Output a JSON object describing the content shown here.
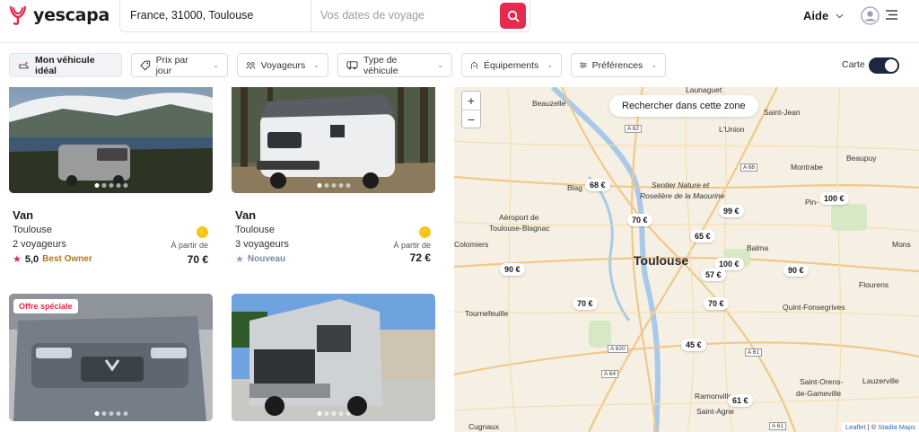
{
  "header": {
    "logo_text": "yescapa",
    "search_location": "France, 31000, Toulouse",
    "search_dates_placeholder": "Vos dates de voyage",
    "help_label": "Aide"
  },
  "filters": {
    "items": [
      {
        "label": "Mon véhicule idéal",
        "icon": "sparkle-van-icon"
      },
      {
        "label": "Prix par jour",
        "icon": "price-tag-icon"
      },
      {
        "label": "Voyageurs",
        "icon": "people-icon"
      },
      {
        "label": "Type de véhicule",
        "icon": "van-icon"
      },
      {
        "label": "Équipements",
        "icon": "equipment-icon"
      },
      {
        "label": "Préférences",
        "icon": "sliders-icon"
      }
    ],
    "map_toggle_label": "Carte",
    "map_toggle_on": true
  },
  "listings": [
    {
      "title": "Van",
      "city": "Toulouse",
      "travelers": "2 voyageurs",
      "rating": "5,0",
      "tag": "Best Owner",
      "from_label": "À partir de",
      "price": "70 €",
      "badge": ""
    },
    {
      "title": "Van",
      "city": "Toulouse",
      "travelers": "3 voyageurs",
      "rating": "",
      "tag": "Nouveau",
      "from_label": "À partir de",
      "price": "72 €",
      "badge": ""
    },
    {
      "badge": "Offre spéciale"
    },
    {
      "badge": ""
    }
  ],
  "map": {
    "search_zone_label": "Rechercher dans cette zone",
    "zoom_in": "+",
    "zoom_out": "−",
    "prices": [
      "68 €",
      "100 €",
      "70 €",
      "99 €",
      "65 €",
      "100 €",
      "57 €",
      "90 €",
      "90 €",
      "70 €",
      "70 €",
      "45 €",
      "61 €"
    ],
    "places": [
      "Beauzelle",
      "Launaguet",
      "Saint-Jean",
      "L'Union",
      "Montrabe",
      "Beaupuy",
      "Blag",
      "Pin-",
      "Sentier Nature et",
      "Roselière de la Maourine",
      "Aéroport de",
      "Toulouse-Blagnac",
      "Colomiers",
      "Balma",
      "Mons",
      "Toulouse",
      "Flourens",
      "Quint-Fonsegrives",
      "Tournefeuille",
      "Saint-Orens-",
      "de-Gameville",
      "Lauzerville",
      "Ramonville",
      "Saint-Agne",
      "Cugnaux"
    ],
    "roads": [
      "A 62",
      "A 68",
      "A 620",
      "A 64",
      "A 61",
      "A 61"
    ],
    "attribution_leaflet": "Leaflet",
    "attribution_sep": "| ©",
    "attribution_stadia": "Stadia Maps"
  },
  "colors": {
    "brand": "#e5294f",
    "toggle": "#1e2741",
    "best_owner": "#b17a1d"
  }
}
